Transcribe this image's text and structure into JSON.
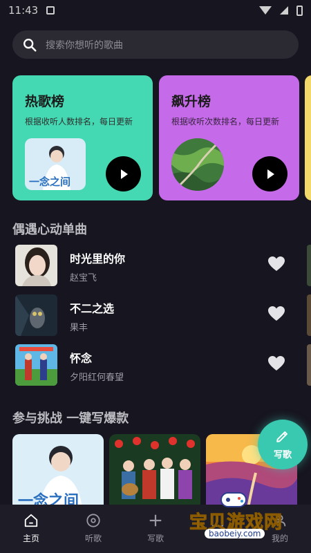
{
  "status_bar": {
    "time": "11:43"
  },
  "search": {
    "placeholder": "搜索你想听的歌曲"
  },
  "chart_cards": [
    {
      "title": "热歌榜",
      "subtitle": "根据收听人数排名，每日更新",
      "cover_text": "一念之间",
      "color": "#44d9b2"
    },
    {
      "title": "飙升榜",
      "subtitle": "根据收听次数排名，每日更新",
      "color": "#c56ae8"
    }
  ],
  "sections": {
    "singles_title": "偶遇心动单曲",
    "challenge_title": "参与挑战 一键写爆款"
  },
  "songs": [
    {
      "title": "时光里的你",
      "artist": "赵宝飞"
    },
    {
      "title": "不二之选",
      "artist": "果丰"
    },
    {
      "title": "怀念",
      "artist": "夕阳红何春望"
    }
  ],
  "challenge_cards": [
    {
      "cover_text": "一念之间"
    },
    {},
    {}
  ],
  "fab": {
    "label": "写歌"
  },
  "tabs": [
    {
      "label": "主页",
      "icon": "home-icon",
      "active": true
    },
    {
      "label": "听歌",
      "icon": "disc-icon"
    },
    {
      "label": "写歌",
      "icon": "plus-icon"
    },
    {
      "label": "",
      "icon": "book-icon"
    },
    {
      "label": "我的",
      "icon": "user-icon"
    }
  ],
  "watermark": {
    "text": "宝贝游戏网",
    "url": "baobeiy.com"
  },
  "colors": {
    "background": "#17151f",
    "accent_teal": "#44d9b2",
    "accent_purple": "#c56ae8"
  }
}
